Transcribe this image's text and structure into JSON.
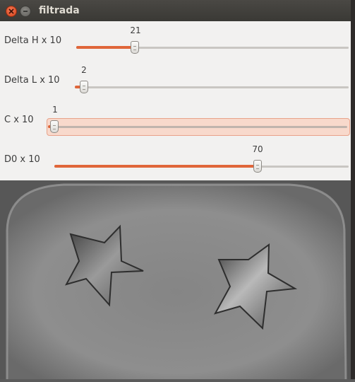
{
  "window": {
    "title": "filtrada",
    "close_icon": "close-icon",
    "minimize_icon": "minimize-icon"
  },
  "sliders": [
    {
      "label": "Delta H x 10",
      "value": "21"
    },
    {
      "label": "Delta L x 10",
      "value": "2"
    },
    {
      "label": "C x 10",
      "value": "1"
    },
    {
      "label": "D0 x 10",
      "value": "70"
    }
  ],
  "colors": {
    "accent": "#e0663a",
    "highlight": "#f8d9cc"
  }
}
